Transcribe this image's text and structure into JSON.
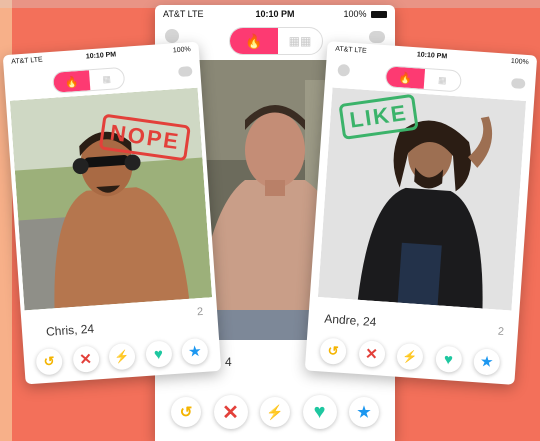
{
  "status": {
    "carrier": "AT&T LTE",
    "time": "10:10 PM",
    "battery": "100%"
  },
  "cards": {
    "left": {
      "name": "Chris, 24",
      "stamp": "NOPE",
      "count": "2"
    },
    "center": {
      "count": "4"
    },
    "right": {
      "name": "Andre, 24",
      "stamp": "LIKE",
      "count": "2"
    }
  },
  "actions": [
    "undo",
    "dislike",
    "boost",
    "like",
    "super-like"
  ],
  "colors": {
    "background": "#f3705a",
    "accent": "#fd3a72",
    "nope": "#e3403a",
    "like": "#3bb36a",
    "undo": "#f4b400",
    "dislike": "#e3403a",
    "boost": "#a64ee8",
    "like_btn": "#1ec7a0",
    "super": "#1c97f0"
  }
}
